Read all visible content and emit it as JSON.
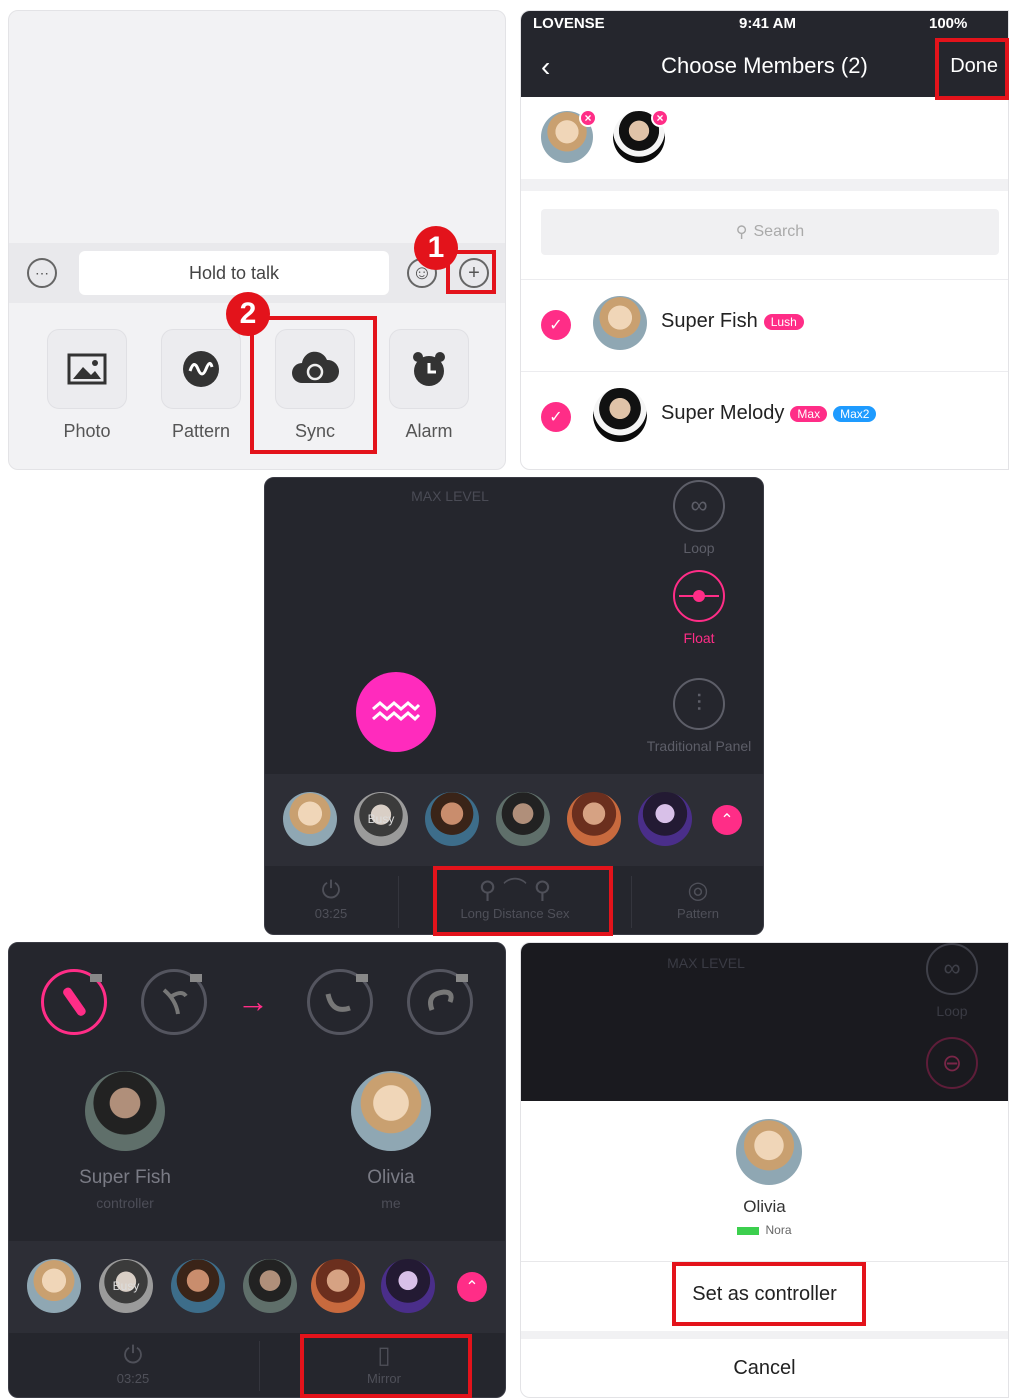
{
  "steps": {
    "one": "1",
    "two": "2"
  },
  "chat": {
    "hold_to_talk": "Hold to talk",
    "tools": [
      {
        "label": "Photo",
        "icon": "image-icon"
      },
      {
        "label": "Pattern",
        "icon": "wave-icon"
      },
      {
        "label": "Sync",
        "icon": "cloud-sync-icon"
      },
      {
        "label": "Alarm",
        "icon": "alarm-clock-icon"
      }
    ]
  },
  "members": {
    "status": {
      "carrier": "LOVENSE",
      "time": "9:41 AM",
      "battery": "100%"
    },
    "title": "Choose Members (2)",
    "done_label": "Done",
    "search_placeholder": "Search",
    "rows": [
      {
        "name": "Super Fish",
        "tags": [
          "Lush"
        ]
      },
      {
        "name": "Super Melody",
        "tags": [
          "Max",
          "Max2"
        ]
      }
    ]
  },
  "control": {
    "max_level": "MAX LEVEL",
    "side": [
      {
        "label": "Loop",
        "icon": "infinity-icon"
      },
      {
        "label": "Float",
        "icon": "float-icon"
      },
      {
        "label": "Traditional Panel",
        "icon": "sliders-icon"
      }
    ],
    "busy_label": "Busy",
    "bottom": [
      {
        "label": "03:25",
        "icon": "power-icon"
      },
      {
        "label": "Long Distance Sex",
        "icon": "location-link-icon"
      },
      {
        "label": "Pattern",
        "icon": "wave-icon"
      }
    ]
  },
  "mirror": {
    "arrow": "→",
    "controller": {
      "name": "Super Fish",
      "role": "controller"
    },
    "me": {
      "name": "Olivia",
      "role": "me"
    },
    "busy_label": "Busy",
    "bottom": [
      {
        "label": "03:25",
        "icon": "power-icon"
      },
      {
        "label": "Mirror",
        "icon": "phone-icon"
      }
    ]
  },
  "sheet": {
    "max_level": "MAX LEVEL",
    "loop_label": "Loop",
    "user_name": "Olivia",
    "device_name": "Nora",
    "set_controller_label": "Set as controller",
    "cancel_label": "Cancel"
  },
  "colors": {
    "accent": "#ff2d87",
    "highlight": "#e3131b",
    "dark_bg": "#25262d"
  }
}
